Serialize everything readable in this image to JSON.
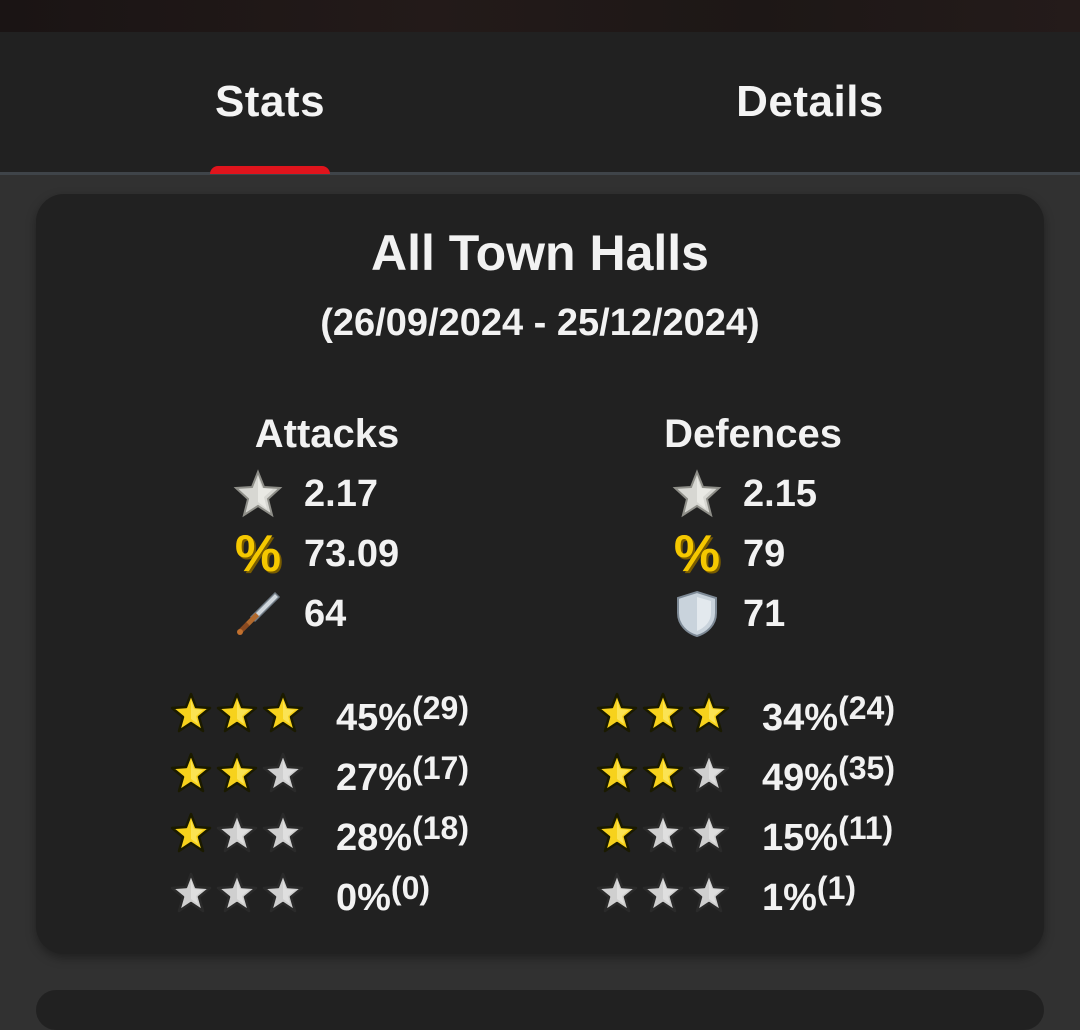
{
  "tabs": [
    {
      "label": "Stats",
      "active": true
    },
    {
      "label": "Details",
      "active": false
    }
  ],
  "accent_color": "#e0141c",
  "card": {
    "title": "All Town Halls",
    "date_range": "(26/09/2024 - 25/12/2024)",
    "attacks": {
      "header": "Attacks",
      "avg_stars": "2.17",
      "avg_percent": "73.09",
      "count": "64",
      "count_icon": "sword-icon"
    },
    "defences": {
      "header": "Defences",
      "avg_stars": "2.15",
      "avg_percent": "79",
      "count": "71",
      "count_icon": "shield-icon"
    },
    "percent_glyph": "%",
    "attack_distribution": [
      {
        "stars": 3,
        "percent": "45%",
        "count": "(29)"
      },
      {
        "stars": 2,
        "percent": "27%",
        "count": "(17)"
      },
      {
        "stars": 1,
        "percent": "28%",
        "count": "(18)"
      },
      {
        "stars": 0,
        "percent": "0%",
        "count": "(0)"
      }
    ],
    "defence_distribution": [
      {
        "stars": 3,
        "percent": "34%",
        "count": "(24)"
      },
      {
        "stars": 2,
        "percent": "49%",
        "count": "(35)"
      },
      {
        "stars": 1,
        "percent": "15%",
        "count": "(11)"
      },
      {
        "stars": 0,
        "percent": "1%",
        "count": "(1)"
      }
    ]
  }
}
